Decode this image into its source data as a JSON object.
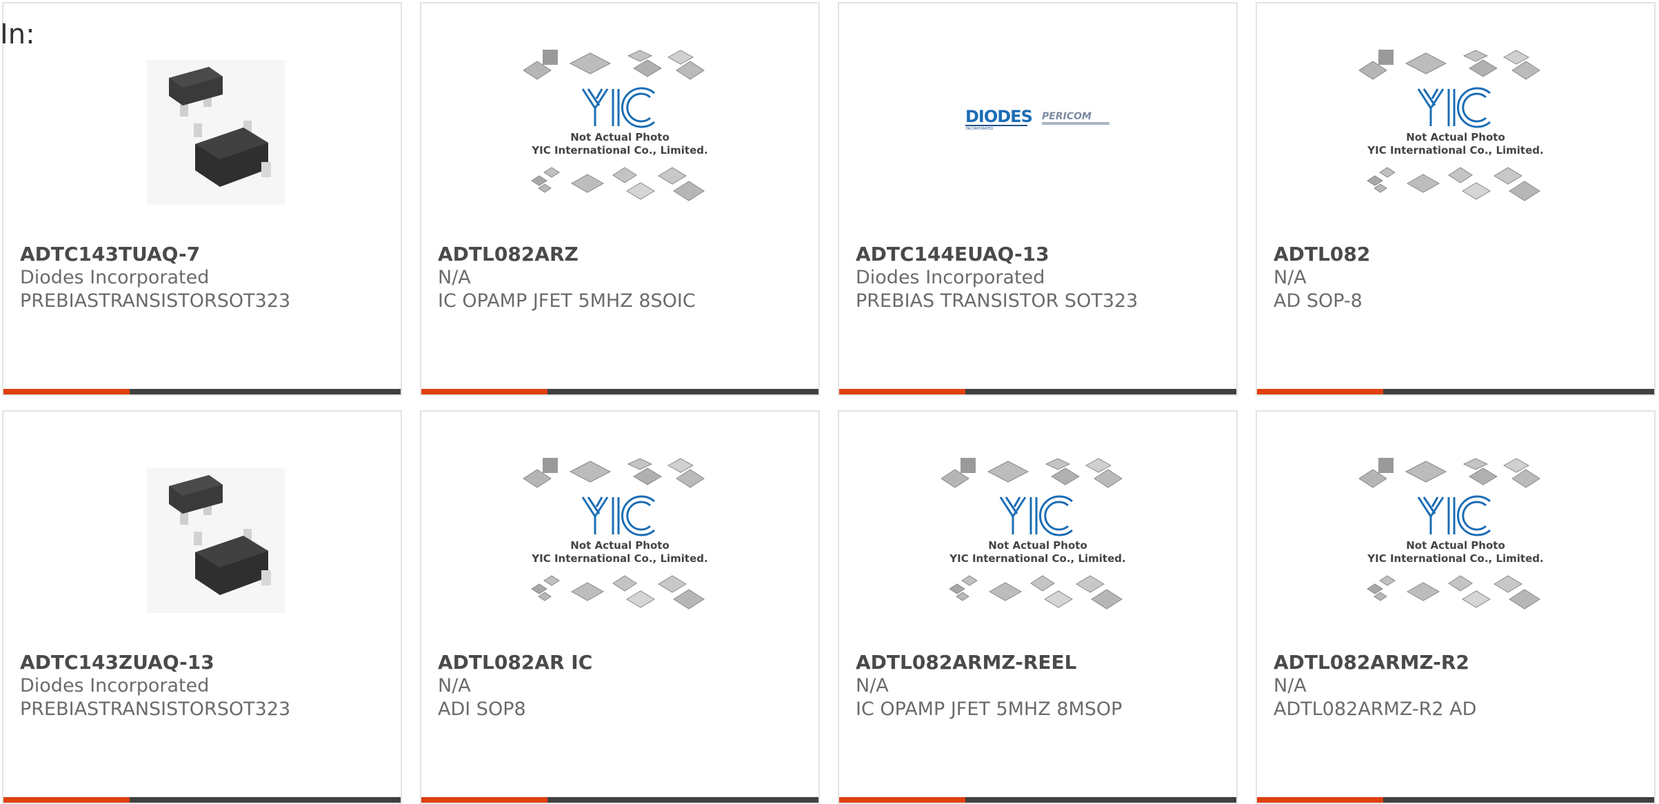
{
  "page": {
    "top_label": "In:"
  },
  "colors": {
    "accent": "#e04010",
    "bar": "#404040",
    "brand_blue": "#1b6db5"
  },
  "placeholder": {
    "line1": "Not Actual Photo",
    "line2": "YIC International Co., Limited.",
    "logo_text": "YIC"
  },
  "logos": {
    "diodes": "DIODES",
    "diodes_sub": "INCORPORATED",
    "pericom": "PERICOM"
  },
  "products": [
    {
      "part_number": "ADTC143TUAQ-7",
      "manufacturer": "Diodes Incorporated",
      "description": "PREBIASTRANSISTORSOT323",
      "image": "transistor-photo"
    },
    {
      "part_number": "ADTL082ARZ",
      "manufacturer": "N/A",
      "description": "IC OPAMP JFET 5MHZ 8SOIC",
      "image": "yic-placeholder"
    },
    {
      "part_number": "ADTC144EUAQ-13",
      "manufacturer": "Diodes Incorporated",
      "description": "PREBIAS TRANSISTOR SOT323",
      "image": "diodes-pericom-logo"
    },
    {
      "part_number": "ADTL082",
      "manufacturer": "N/A",
      "description": "AD SOP-8",
      "image": "yic-placeholder"
    },
    {
      "part_number": "ADTC143ZUAQ-13",
      "manufacturer": "Diodes Incorporated",
      "description": "PREBIASTRANSISTORSOT323",
      "image": "transistor-photo"
    },
    {
      "part_number": "ADTL082AR IC",
      "manufacturer": "N/A",
      "description": "ADI SOP8",
      "image": "yic-placeholder"
    },
    {
      "part_number": "ADTL082ARMZ-REEL",
      "manufacturer": "N/A",
      "description": "IC OPAMP JFET 5MHZ 8MSOP",
      "image": "yic-placeholder"
    },
    {
      "part_number": "ADTL082ARMZ-R2",
      "manufacturer": "N/A",
      "description": "ADTL082ARMZ-R2 AD",
      "image": "yic-placeholder"
    }
  ]
}
